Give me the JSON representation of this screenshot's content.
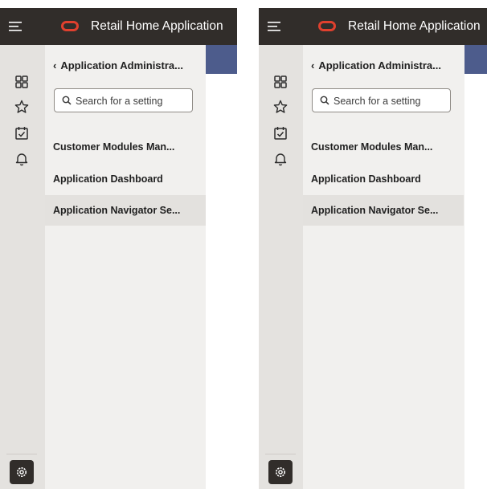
{
  "app": {
    "title": "Retail Home Application"
  },
  "nav": {
    "back_label": "Application Administra...",
    "search_placeholder": "Search for a setting",
    "items": [
      {
        "label": "Customer Modules Man...",
        "selected": false
      },
      {
        "label": "Application Dashboard",
        "selected": false
      },
      {
        "label": "Application Navigator Se...",
        "selected": true
      }
    ]
  },
  "rail": {
    "icons": [
      "grid-icon",
      "star-icon",
      "calendar-check-icon",
      "bell-icon"
    ],
    "settings_icon": "gear-icon"
  },
  "colors": {
    "topbar": "#312d2a",
    "logo": "#e0402e",
    "accent_strip": "#4d5c8c",
    "panel_bg": "#f1f0ee",
    "rail_bg": "#e4e2df",
    "selected_bg": "#e3e1de"
  }
}
